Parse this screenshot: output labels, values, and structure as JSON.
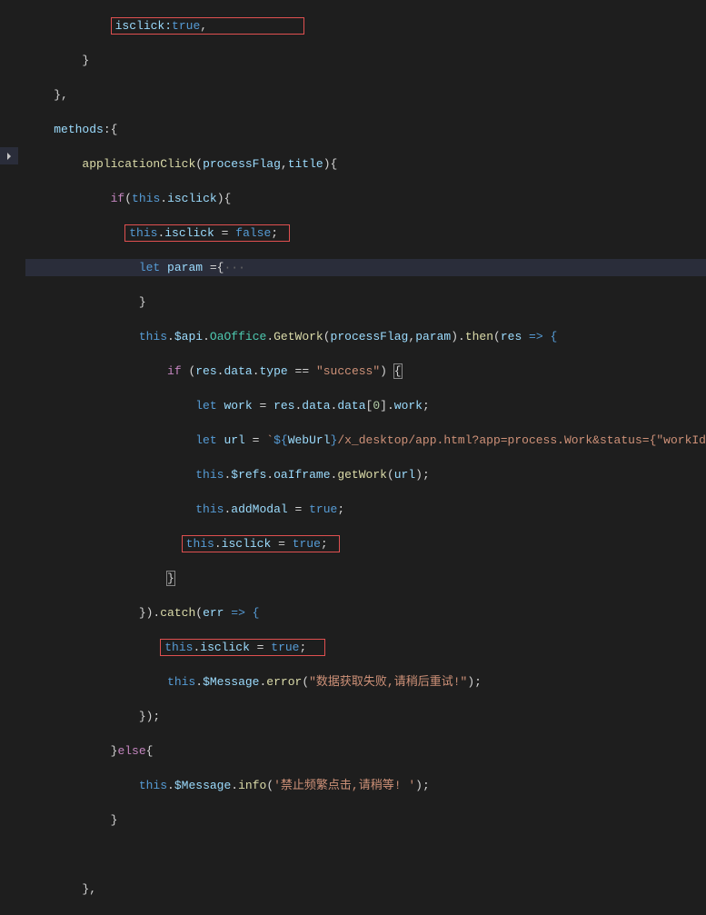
{
  "code": {
    "l1a": "isclick:",
    "l1b": "true",
    "l1c": ",",
    "l2": "}",
    "l3": "},",
    "l4a": "methods",
    "l4b": ":{",
    "l5a": "applicationClick",
    "l5b": "(",
    "l5c": "processFlag",
    "l5d": ",",
    "l5e": "title",
    "l5f": "){",
    "l6a": "if",
    "l6b": "(",
    "l6c": "this",
    "l6d": ".",
    "l6e": "isclick",
    "l6f": "){",
    "l7a": "this",
    "l7b": ".",
    "l7c": "isclick",
    "l7d": " = ",
    "l7e": "false",
    "l7f": ";",
    "l8a": "let",
    "l8b": " ",
    "l8c": "param",
    "l8d": " ={",
    "l8e": "···",
    "l9": "}",
    "l10a": "this",
    "l10b": ".",
    "l10c": "$api",
    "l10d": ".",
    "l10e": "OaOffice",
    "l10f": ".",
    "l10g": "GetWork",
    "l10h": "(",
    "l10i": "processFlag",
    "l10j": ",",
    "l10k": "param",
    "l10l": ").",
    "l10m": "then",
    "l10n": "(",
    "l10o": "res",
    "l10p": " => {",
    "l11a": "if",
    "l11b": " (",
    "l11c": "res",
    "l11d": ".",
    "l11e": "data",
    "l11f": ".",
    "l11g": "type",
    "l11h": " == ",
    "l11i": "\"success\"",
    "l11j": ") ",
    "l11k": "{",
    "l12a": "let",
    "l12b": " ",
    "l12c": "work",
    "l12d": " = ",
    "l12e": "res",
    "l12f": ".",
    "l12g": "data",
    "l12h": ".",
    "l12i": "data",
    "l12j": "[",
    "l12k": "0",
    "l12l": "].",
    "l12m": "work",
    "l12n": ";",
    "l13a": "let",
    "l13b": " ",
    "l13c": "url",
    "l13d": " = ",
    "l13e": "`",
    "l13f": "${",
    "l13g": "WebUrl",
    "l13h": "}",
    "l13i": "/x_desktop/app.html?app=process.Work&status={\"workId\":\"",
    "l14a": "this",
    "l14b": ".",
    "l14c": "$refs",
    "l14d": ".",
    "l14e": "oaIframe",
    "l14f": ".",
    "l14g": "getWork",
    "l14h": "(",
    "l14i": "url",
    "l14j": ");",
    "l15a": "this",
    "l15b": ".",
    "l15c": "addModal",
    "l15d": " = ",
    "l15e": "true",
    "l15f": ";",
    "l16a": "this",
    "l16b": ".",
    "l16c": "isclick",
    "l16d": " = ",
    "l16e": "true",
    "l16f": ";",
    "l17": "}",
    "l18a": "}).",
    "l18b": "catch",
    "l18c": "(",
    "l18d": "err",
    "l18e": " => {",
    "l19a": "this",
    "l19b": ".",
    "l19c": "isclick",
    "l19d": " = ",
    "l19e": "true",
    "l19f": ";",
    "l20a": "this",
    "l20b": ".",
    "l20c": "$Message",
    "l20d": ".",
    "l20e": "error",
    "l20f": "(",
    "l20g": "\"数据获取失败,请稍后重试!\"",
    "l20h": ");",
    "l21": "});",
    "l22a": "}",
    "l22b": "else",
    "l22c": "{",
    "l23a": "this",
    "l23b": ".",
    "l23c": "$Message",
    "l23d": ".",
    "l23e": "info",
    "l23f": "(",
    "l23g": "'禁止频繁点击,请稍等! '",
    "l23h": ");",
    "l24": "}",
    "l25": "},"
  }
}
